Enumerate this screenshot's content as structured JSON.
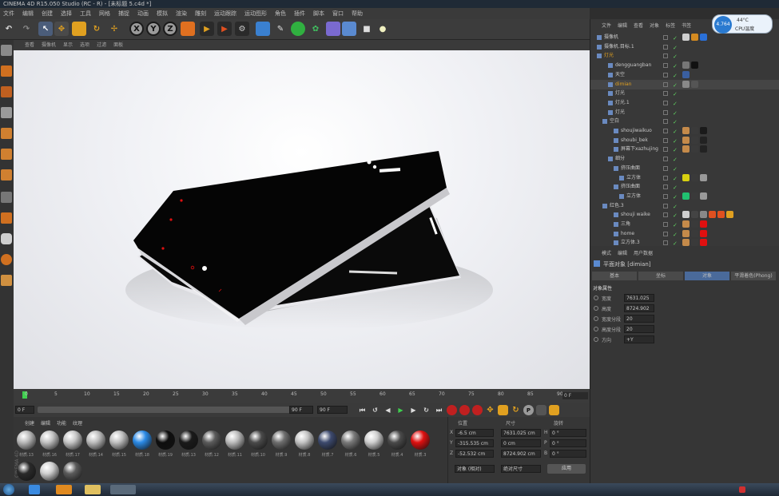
{
  "window": {
    "title": "CINEMA 4D R15.050 Studio (RC - R) - [未标题 5.c4d *]"
  },
  "menu": [
    "文件",
    "编辑",
    "创建",
    "选择",
    "工具",
    "网格",
    "捕捉",
    "动画",
    "模拟",
    "渲染",
    "雕刻",
    "运动跟踪",
    "运动图形",
    "角色",
    "插件",
    "脚本",
    "窗口",
    "帮助"
  ],
  "toolbar": {
    "x": "X",
    "y": "Y",
    "z": "Z"
  },
  "viewport": {
    "menu": [
      "查看",
      "摄像机",
      "显示",
      "选项",
      "过滤",
      "面板"
    ]
  },
  "timeline": {
    "ticks": [
      "0",
      "5",
      "10",
      "15",
      "20",
      "25",
      "30",
      "35",
      "40",
      "45",
      "50",
      "55",
      "60",
      "65",
      "70",
      "75",
      "80",
      "85",
      "90"
    ],
    "end_label": "0 F"
  },
  "playbar": {
    "start_frame": "0 F",
    "current": "0 F",
    "range_end": "90 F",
    "end_frame": "90 F"
  },
  "materials": {
    "menu": [
      "创建",
      "编辑",
      "功能",
      "纹理"
    ],
    "items": [
      {
        "label": "材质.13",
        "color": "#b9b9b9"
      },
      {
        "label": "材质.16",
        "color": "#c2c2c2"
      },
      {
        "label": "材质.17",
        "color": "#c7c7c7"
      },
      {
        "label": "材质.14",
        "color": "#bdbdbd"
      },
      {
        "label": "材质.15",
        "color": "#c0c0c0"
      },
      {
        "label": "材质.18",
        "color": "#2b8ae6"
      },
      {
        "label": "材质.19",
        "color": "#0e0e0e"
      },
      {
        "label": "材质.13",
        "color": "#1a1a1a"
      },
      {
        "label": "材质.12",
        "color": "#5b5b5b"
      },
      {
        "label": "材质.11",
        "color": "#bcbcbc"
      },
      {
        "label": "材质.10",
        "color": "#4a4a4a"
      },
      {
        "label": "材质.9",
        "color": "#6e6e6e"
      },
      {
        "label": "材质.8",
        "color": "#c4c4c4"
      },
      {
        "label": "材质.7",
        "color": "#3d4a6e"
      },
      {
        "label": "材质.6",
        "color": "#7a7a7a"
      },
      {
        "label": "材质.5",
        "color": "#cfcfcf"
      },
      {
        "label": "材质.4",
        "color": "#4a4a4a"
      },
      {
        "label": "材质.3",
        "color": "#e01010"
      },
      {
        "label": "",
        "color": "#2a2a2a"
      },
      {
        "label": "",
        "color": "#cfcfcf"
      },
      {
        "label": "",
        "color": "#5b5b5b"
      }
    ],
    "side_label": "CINEMA 4D"
  },
  "coords": {
    "headers": [
      "位置",
      "尺寸",
      "旋转"
    ],
    "rows": [
      {
        "axis": "X",
        "pos": "-6.5 cm",
        "size": "7631.025 cm",
        "rlabel": "H",
        "rot": "0 °"
      },
      {
        "axis": "Y",
        "pos": "-315.535 cm",
        "size": "0 cm",
        "rlabel": "P",
        "rot": "0 °"
      },
      {
        "axis": "Z",
        "pos": "-52.532 cm",
        "size": "8724.902 cm",
        "rlabel": "B",
        "rot": "0 °"
      }
    ],
    "mode": "对象 (相对)",
    "size_mode": "绝对尺寸",
    "apply": "应用"
  },
  "objmgr": {
    "menu": [
      "文件",
      "编辑",
      "查看",
      "对象",
      "标签",
      "书签"
    ],
    "rows": [
      {
        "name": "摄像机",
        "indent": 0,
        "color": "#c8c8c8",
        "tags": [
          "#cfcfcf",
          "#d48a20",
          "#2a70d8"
        ]
      },
      {
        "name": "摄像机.目标.1",
        "indent": 0,
        "color": "#c8c8c8",
        "tags": []
      },
      {
        "name": "灯光",
        "indent": 0,
        "color": "#e0a020",
        "tags": []
      },
      {
        "name": "dengguangban",
        "indent": 2,
        "color": "#c8c8c8",
        "tags": [
          "#777777",
          "#111111"
        ]
      },
      {
        "name": "天空",
        "indent": 2,
        "color": "#c8c8c8",
        "tags": [
          "#3a5fa0"
        ]
      },
      {
        "name": "dimian",
        "indent": 2,
        "color": "#e0a020",
        "tags": [
          "#888888",
          "#555555"
        ]
      },
      {
        "name": "灯光",
        "indent": 2,
        "color": "#c8c8c8",
        "tags": []
      },
      {
        "name": "灯光.1",
        "indent": 2,
        "color": "#c8c8c8",
        "tags": []
      },
      {
        "name": "灯光",
        "indent": 2,
        "color": "#c8c8c8",
        "tags": []
      },
      {
        "name": "空白",
        "indent": 1,
        "color": "#c8c8c8",
        "tags": []
      },
      {
        "name": "shoujiwaikuo",
        "indent": 3,
        "color": "#c8c8c8",
        "tags": [
          "#c48a4a",
          "#3a3a3a",
          "#1a1a1a"
        ]
      },
      {
        "name": "shoubi_bek",
        "indent": 3,
        "color": "#c8c8c8",
        "tags": [
          "#c48a4a",
          "#3a3a3a",
          "#222222"
        ]
      },
      {
        "name": "屏幕下xazhujing",
        "indent": 3,
        "color": "#c8c8c8",
        "tags": [
          "#c48a4a",
          "#3a3a3a",
          "#222222"
        ]
      },
      {
        "name": "细分",
        "indent": 2,
        "color": "#c8c8c8",
        "tags": []
      },
      {
        "name": "挤压曲面",
        "indent": 3,
        "color": "#c8c8c8",
        "tags": []
      },
      {
        "name": "立方体",
        "indent": 4,
        "color": "#c8c8c8",
        "tags": [
          "#d8d010",
          "#3a3a3a",
          "#999999"
        ]
      },
      {
        "name": "挤压曲面",
        "indent": 3,
        "color": "#c8c8c8",
        "tags": []
      },
      {
        "name": "立方体",
        "indent": 4,
        "color": "#c8c8c8",
        "tags": [
          "#20c070",
          "#3a3a3a",
          "#999999"
        ]
      },
      {
        "name": "红色.3",
        "indent": 1,
        "color": "#c8c8c8",
        "tags": []
      },
      {
        "name": "shouji waike",
        "indent": 3,
        "color": "#c8c8c8",
        "tags": [
          "#cfcfcf",
          "#444444",
          "#888888",
          "#e05020",
          "#e05020",
          "#e0a020"
        ]
      },
      {
        "name": "三角",
        "indent": 3,
        "color": "#c8c8c8",
        "tags": [
          "#c48a4a",
          "#3a3a3a",
          "#e01010"
        ]
      },
      {
        "name": "home",
        "indent": 3,
        "color": "#c8c8c8",
        "tags": [
          "#c48a4a",
          "#3a3a3a",
          "#e01010"
        ]
      },
      {
        "name": "立方体.3",
        "indent": 3,
        "color": "#c8c8c8",
        "tags": [
          "#c48a4a",
          "#3a3a3a",
          "#e01010"
        ]
      }
    ]
  },
  "attrmgr": {
    "menu": [
      "模式",
      "编辑",
      "用户数据"
    ],
    "object_title": "平面对象 [dimian]",
    "tabs": [
      "基本",
      "坐标",
      "对象",
      "平滑着色(Phong)"
    ],
    "section": "对象属性",
    "fields": [
      {
        "label": "宽度",
        "value": "7631.025"
      },
      {
        "label": "高度",
        "value": "8724.902"
      },
      {
        "label": "宽度分段",
        "value": "20"
      },
      {
        "label": "高度分段",
        "value": "20"
      },
      {
        "label": "方向",
        "value": "+Y"
      }
    ]
  },
  "cpu": {
    "value": "4.764",
    "temp": "44°C",
    "label": "CPU温度"
  },
  "colors": {
    "accent": "#e0a020",
    "selected_tab": "#4a6a9a"
  }
}
